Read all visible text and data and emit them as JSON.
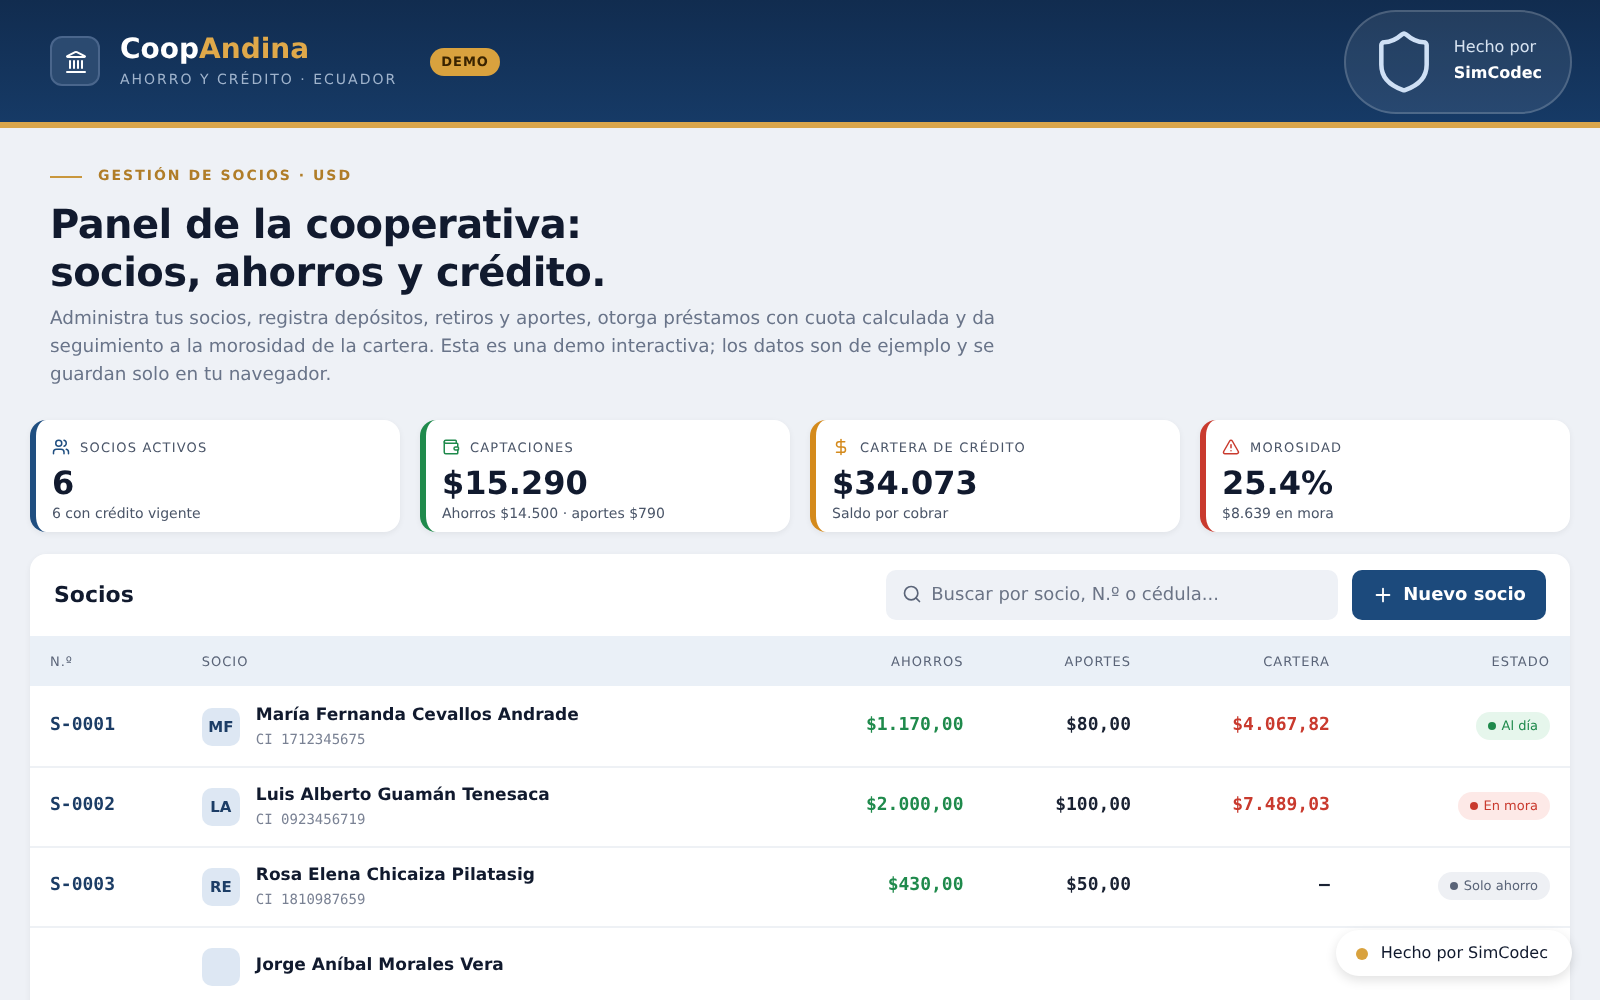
{
  "brand": {
    "name_first": "Coop",
    "name_second": "Andina",
    "subtitle": "AHORRO Y CRÉDITO · ECUADOR",
    "badge": "DEMO"
  },
  "maker": {
    "line1": "Hecho por",
    "line2": "SimCodec"
  },
  "hero": {
    "eyebrow": "GESTIÓN DE SOCIOS · USD",
    "title_line1": "Panel de la cooperativa:",
    "title_line2": "socios, ahorros y crédito.",
    "description": "Administra tus socios, registra depósitos, retiros y aportes, otorga préstamos con cuota calculada y da seguimiento a la morosidad de la cartera. Esta es una demo interactiva; los datos son de ejemplo y se guardan solo en tu navegador."
  },
  "stats": [
    {
      "kind": "users",
      "label": "SOCIOS ACTIVOS",
      "value": "6",
      "note": "6 con crédito vigente",
      "color": "#1f4e80"
    },
    {
      "kind": "wallet",
      "label": "CAPTACIONES",
      "value": "$15.290",
      "note": "Ahorros $14.500 · aportes $790",
      "color": "#1f8a4c"
    },
    {
      "kind": "dollar",
      "label": "CARTERA DE CRÉDITO",
      "value": "$34.073",
      "note": "Saldo por cobrar",
      "color": "#d48a1c"
    },
    {
      "kind": "alert",
      "label": "MOROSIDAD",
      "value": "25.4%",
      "note": "$8.639 en mora",
      "color": "#c93a2e"
    }
  ],
  "table": {
    "title": "Socios",
    "search": {
      "placeholder": "Buscar por socio, N.º o cédula..."
    },
    "add_button": "Nuevo socio",
    "columns": [
      "N.º",
      "SOCIO",
      "AHORROS",
      "APORTES",
      "CARTERA",
      "ESTADO"
    ],
    "rows": [
      {
        "id": "S-0001",
        "initials": "MF",
        "name": "María Fernanda Cevallos Andrade",
        "ci": "CI 1712345675",
        "ahorros": "$1.170,00",
        "aportes": "$80,00",
        "cartera": {
          "text": "$4.067,82",
          "color": "#c93a2e"
        },
        "status": {
          "kind": "ok",
          "label": "Al día"
        }
      },
      {
        "id": "S-0002",
        "initials": "LA",
        "name": "Luis Alberto Guamán Tenesaca",
        "ci": "CI 0923456719",
        "ahorros": "$2.000,00",
        "aportes": "$100,00",
        "cartera": {
          "text": "$7.489,03",
          "color": "#c93a2e"
        },
        "status": {
          "kind": "late",
          "label": "En mora"
        }
      },
      {
        "id": "S-0003",
        "initials": "RE",
        "name": "Rosa Elena Chicaiza Pilatasig",
        "ci": "CI 1810987659",
        "ahorros": "$430,00",
        "aportes": "$50,00",
        "cartera": {
          "text": "—",
          "color": "#1a2233"
        },
        "status": {
          "kind": "savings",
          "label": "Solo ahorro"
        }
      },
      {
        "name": "Jorge Aníbal Morales Vera"
      }
    ]
  },
  "floating_badge": {
    "label": "Hecho por SimCodec"
  }
}
